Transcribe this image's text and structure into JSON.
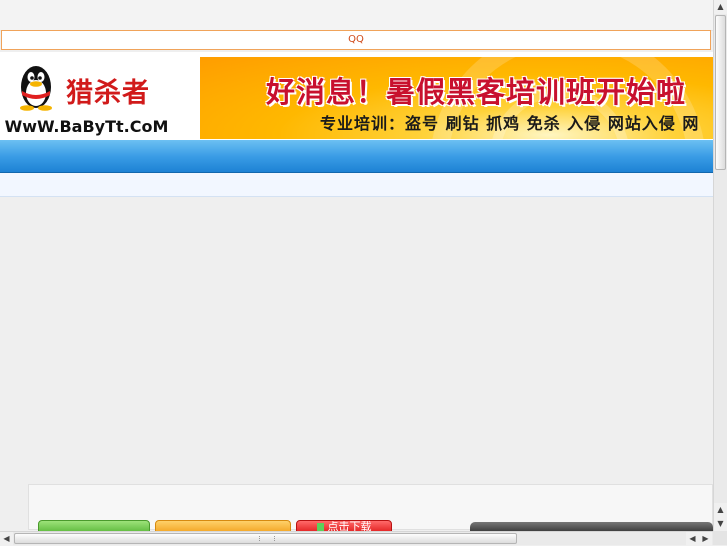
{
  "notice": {
    "text": "QQ"
  },
  "logo": {
    "cn_name": "猎杀者",
    "url_text": "WwW.BaByTt.CoM"
  },
  "banner": {
    "headline": "好消息！暑假黑客培训班开始啦",
    "subline": "专业培训：盗号 刷钻 抓鸡 免杀 入侵 网站入侵 网"
  },
  "buttons": {
    "download": "点击下载"
  },
  "scrollbar": {
    "up": "▲",
    "down": "▼",
    "left": "◀",
    "right": "▶"
  },
  "colors": {
    "nav_blue": "#3b9de6",
    "banner_orange": "#ffb800",
    "headline_red": "#c8102e"
  }
}
